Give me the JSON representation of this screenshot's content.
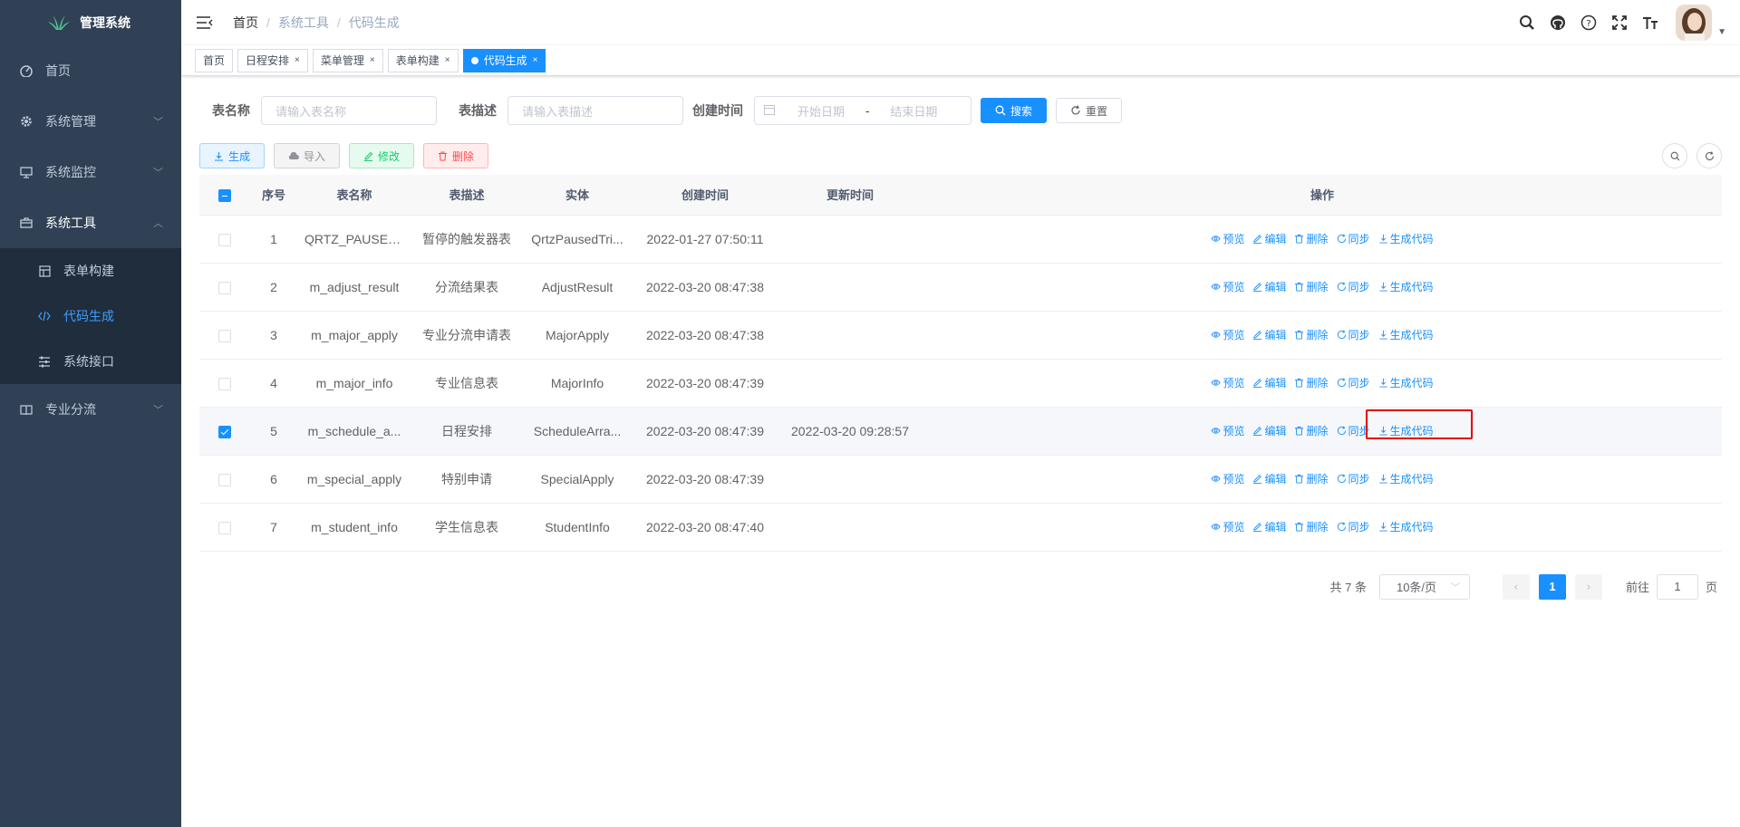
{
  "app": {
    "title": "管理系统"
  },
  "sidebar": {
    "items": [
      {
        "label": "首页",
        "icon": "dashboard-icon"
      },
      {
        "label": "系统管理",
        "icon": "gear-icon"
      },
      {
        "label": "系统监控",
        "icon": "monitor-icon"
      },
      {
        "label": "系统工具",
        "icon": "toolbox-icon",
        "expanded": true
      },
      {
        "label": "专业分流",
        "icon": "book-icon"
      }
    ],
    "tools_sub": [
      {
        "label": "表单构建",
        "icon": "form-icon"
      },
      {
        "label": "代码生成",
        "icon": "code-icon",
        "active": true
      },
      {
        "label": "系统接口",
        "icon": "sliders-icon"
      }
    ]
  },
  "breadcrumb": [
    "首页",
    "系统工具",
    "代码生成"
  ],
  "tags": [
    "首页",
    "日程安排",
    "菜单管理",
    "表单构建",
    "代码生成"
  ],
  "search": {
    "table_name_label": "表名称",
    "table_name_placeholder": "请输入表名称",
    "table_desc_label": "表描述",
    "table_desc_placeholder": "请输入表描述",
    "created_label": "创建时间",
    "start_placeholder": "开始日期",
    "range_sep": "-",
    "end_placeholder": "结束日期",
    "search_btn": "搜索",
    "reset_btn": "重置"
  },
  "toolbar": {
    "generate": "生成",
    "import": "导入",
    "edit": "修改",
    "delete": "删除"
  },
  "table": {
    "headers": [
      "序号",
      "表名称",
      "表描述",
      "实体",
      "创建时间",
      "更新时间",
      "操作"
    ],
    "ops": [
      "预览",
      "编辑",
      "删除",
      "同步",
      "生成代码"
    ],
    "rows": [
      {
        "no": "1",
        "name": "QRTZ_PAUSED...",
        "desc": "暂停的触发器表",
        "entity": "QrtzPausedTri...",
        "created": "2022-01-27 07:50:11",
        "updated": "",
        "checked": false
      },
      {
        "no": "2",
        "name": "m_adjust_result",
        "desc": "分流结果表",
        "entity": "AdjustResult",
        "created": "2022-03-20 08:47:38",
        "updated": "",
        "checked": false
      },
      {
        "no": "3",
        "name": "m_major_apply",
        "desc": "专业分流申请表",
        "entity": "MajorApply",
        "created": "2022-03-20 08:47:38",
        "updated": "",
        "checked": false
      },
      {
        "no": "4",
        "name": "m_major_info",
        "desc": "专业信息表",
        "entity": "MajorInfo",
        "created": "2022-03-20 08:47:39",
        "updated": "",
        "checked": false
      },
      {
        "no": "5",
        "name": "m_schedule_a...",
        "desc": "日程安排",
        "entity": "ScheduleArra...",
        "created": "2022-03-20 08:47:39",
        "updated": "2022-03-20 09:28:57",
        "checked": true
      },
      {
        "no": "6",
        "name": "m_special_apply",
        "desc": "特别申请",
        "entity": "SpecialApply",
        "created": "2022-03-20 08:47:39",
        "updated": "",
        "checked": false
      },
      {
        "no": "7",
        "name": "m_student_info",
        "desc": "学生信息表",
        "entity": "StudentInfo",
        "created": "2022-03-20 08:47:40",
        "updated": "",
        "checked": false
      }
    ]
  },
  "pagination": {
    "total": "共 7 条",
    "page_size": "10条/页",
    "current": "1",
    "goto_label": "前往",
    "goto_value": "1",
    "page_unit": "页"
  },
  "colors": {
    "primary": "#1890ff",
    "sidebar_bg": "#304156",
    "highlight": "#e30000"
  }
}
